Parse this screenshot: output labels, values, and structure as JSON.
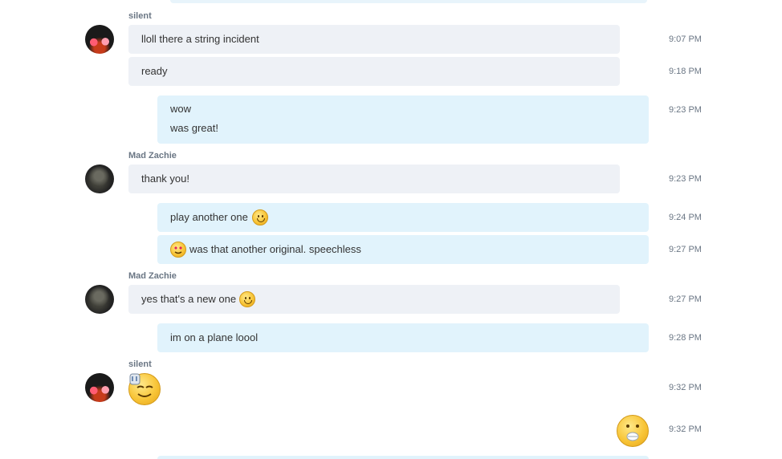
{
  "messages": [
    {
      "sender": "silent"
    },
    {
      "text": "lloll there a string incident",
      "time": "9:07 PM"
    },
    {
      "text": "ready",
      "time": "9:18 PM"
    },
    {
      "lines": [
        "wow",
        "was great!"
      ],
      "time": "9:23 PM"
    },
    {
      "sender": "Mad Zachie"
    },
    {
      "text": "thank you!",
      "time": "9:23 PM"
    },
    {
      "text": "play another one",
      "time": "9:24 PM"
    },
    {
      "text": "was that another original.  speechless",
      "time": "9:27 PM"
    },
    {
      "sender": "Mad Zachie"
    },
    {
      "text": "yes that's a new one",
      "time": "9:27 PM"
    },
    {
      "text": "im on a plane loool",
      "time": "9:28 PM"
    },
    {
      "sender": "silent"
    },
    {
      "time": "9:32 PM"
    },
    {
      "time": "9:32 PM"
    }
  ],
  "icons": [
    "smile-emoticon",
    "heart-eyes-emoticon",
    "rock-on-emoticon",
    "speechless-emoticon"
  ],
  "colors": {
    "incoming_bubble": "#eef1f6",
    "outgoing_bubble": "#e1f3fc",
    "meta_text": "#6a7684"
  }
}
